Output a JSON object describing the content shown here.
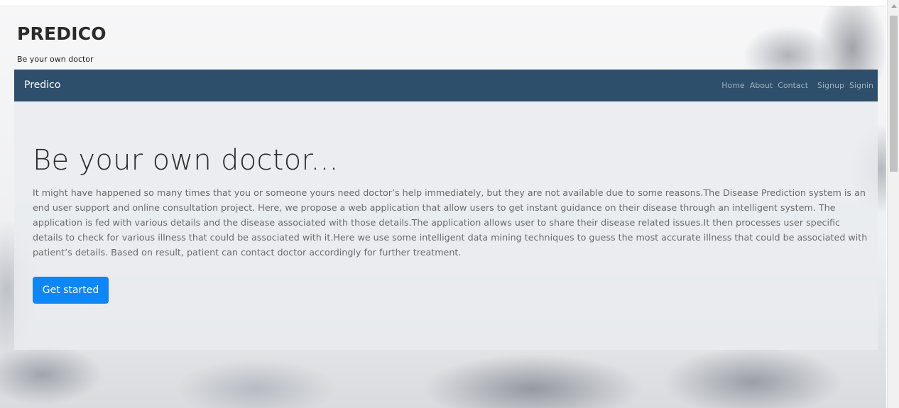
{
  "header": {
    "title": "PREDICO",
    "tagline": "Be your own doctor"
  },
  "navbar": {
    "brand": "Predico",
    "links": [
      "Home",
      "About",
      "Contact",
      "Signup",
      "Signin"
    ]
  },
  "hero": {
    "heading": "Be your own doctor...",
    "paragraph": "It might have happened so many times that you or someone yours need doctor’s help immediately, but they are not available due to some reasons.The Disease Prediction system is an end user support and online consultation project. Here, we propose a web application that allow users to get instant guidance on their disease through an intelligent system. The application is fed with various details and the disease associated with those details.The application allows user to share their disease related issues.It then processes user specific details to check for various illness that could be associated with it.Here we use some intelligent data mining techniques to guess the most accurate illness that could be associated with patient’s details. Based on result, patient can contact doctor accordingly for further treatment.",
    "cta_label": "Get started"
  },
  "colors": {
    "navbar_bg": "#2d4f6b",
    "jumbotron_bg": "#e9ecef",
    "button_primary": "#0d86f7"
  },
  "icons": [
    "scroll-up-arrow-icon"
  ]
}
